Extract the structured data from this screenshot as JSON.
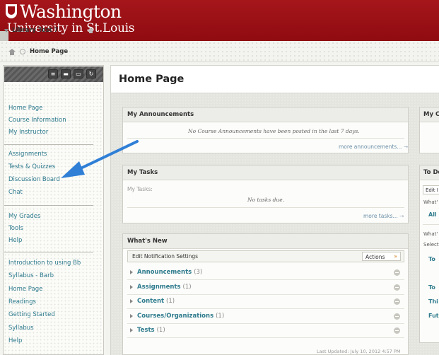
{
  "header": {
    "logo_line1": "Washington",
    "logo_line2": "University in St.Louis"
  },
  "breadcrumb": {
    "current": "Home Page"
  },
  "sidebar": {
    "course_title": "Library Test 7",
    "group1": [
      "Home Page",
      "Course Information",
      "My Instructor"
    ],
    "group2": [
      "Assignments",
      "Tests & Quizzes",
      "Discussion Board",
      "Chat"
    ],
    "group3": [
      "My Grades",
      "Tools",
      "Help"
    ],
    "group4": [
      "Introduction to using Bb",
      "Syllabus - Barb",
      "Home Page",
      "Readings",
      "Getting Started",
      "Syllabus",
      "Help"
    ]
  },
  "main": {
    "page_title": "Home Page",
    "announcements": {
      "title": "My Announcements",
      "message": "No Course Announcements have been posted in the last 7 days.",
      "more": "more announcements...",
      "more_arrow": "→"
    },
    "tasks": {
      "title": "My Tasks",
      "label": "My Tasks:",
      "message": "No tasks due.",
      "more": "more tasks...",
      "more_arrow": "→"
    },
    "whats_new": {
      "title": "What's New",
      "edit_notifications": "Edit Notification Settings",
      "actions": "Actions",
      "actions_chevron": "»",
      "items": [
        {
          "label": "Announcements",
          "count": "(3)"
        },
        {
          "label": "Assignments",
          "count": "(1)"
        },
        {
          "label": "Content",
          "count": "(1)"
        },
        {
          "label": "Courses/Organizations",
          "count": "(1)"
        },
        {
          "label": "Tests",
          "count": "(1)"
        }
      ],
      "last_updated": "Last Updated: July 10, 2012 4:57 PM"
    }
  },
  "right_column": {
    "calendar_title": "My Ca",
    "todo_title": "To Do",
    "todo_edit": "Edit I",
    "todo_whats1": "What'",
    "todo_all": "All",
    "todo_whats2": "What'",
    "todo_select": "Select",
    "todo_to": "To",
    "todo_to2": "To",
    "todo_th": "Thi",
    "todo_fu": "Fut"
  },
  "colors": {
    "header_red": "#9b0e13",
    "link_teal": "#2e7b8d",
    "arrow_blue": "#2f7fd6"
  }
}
